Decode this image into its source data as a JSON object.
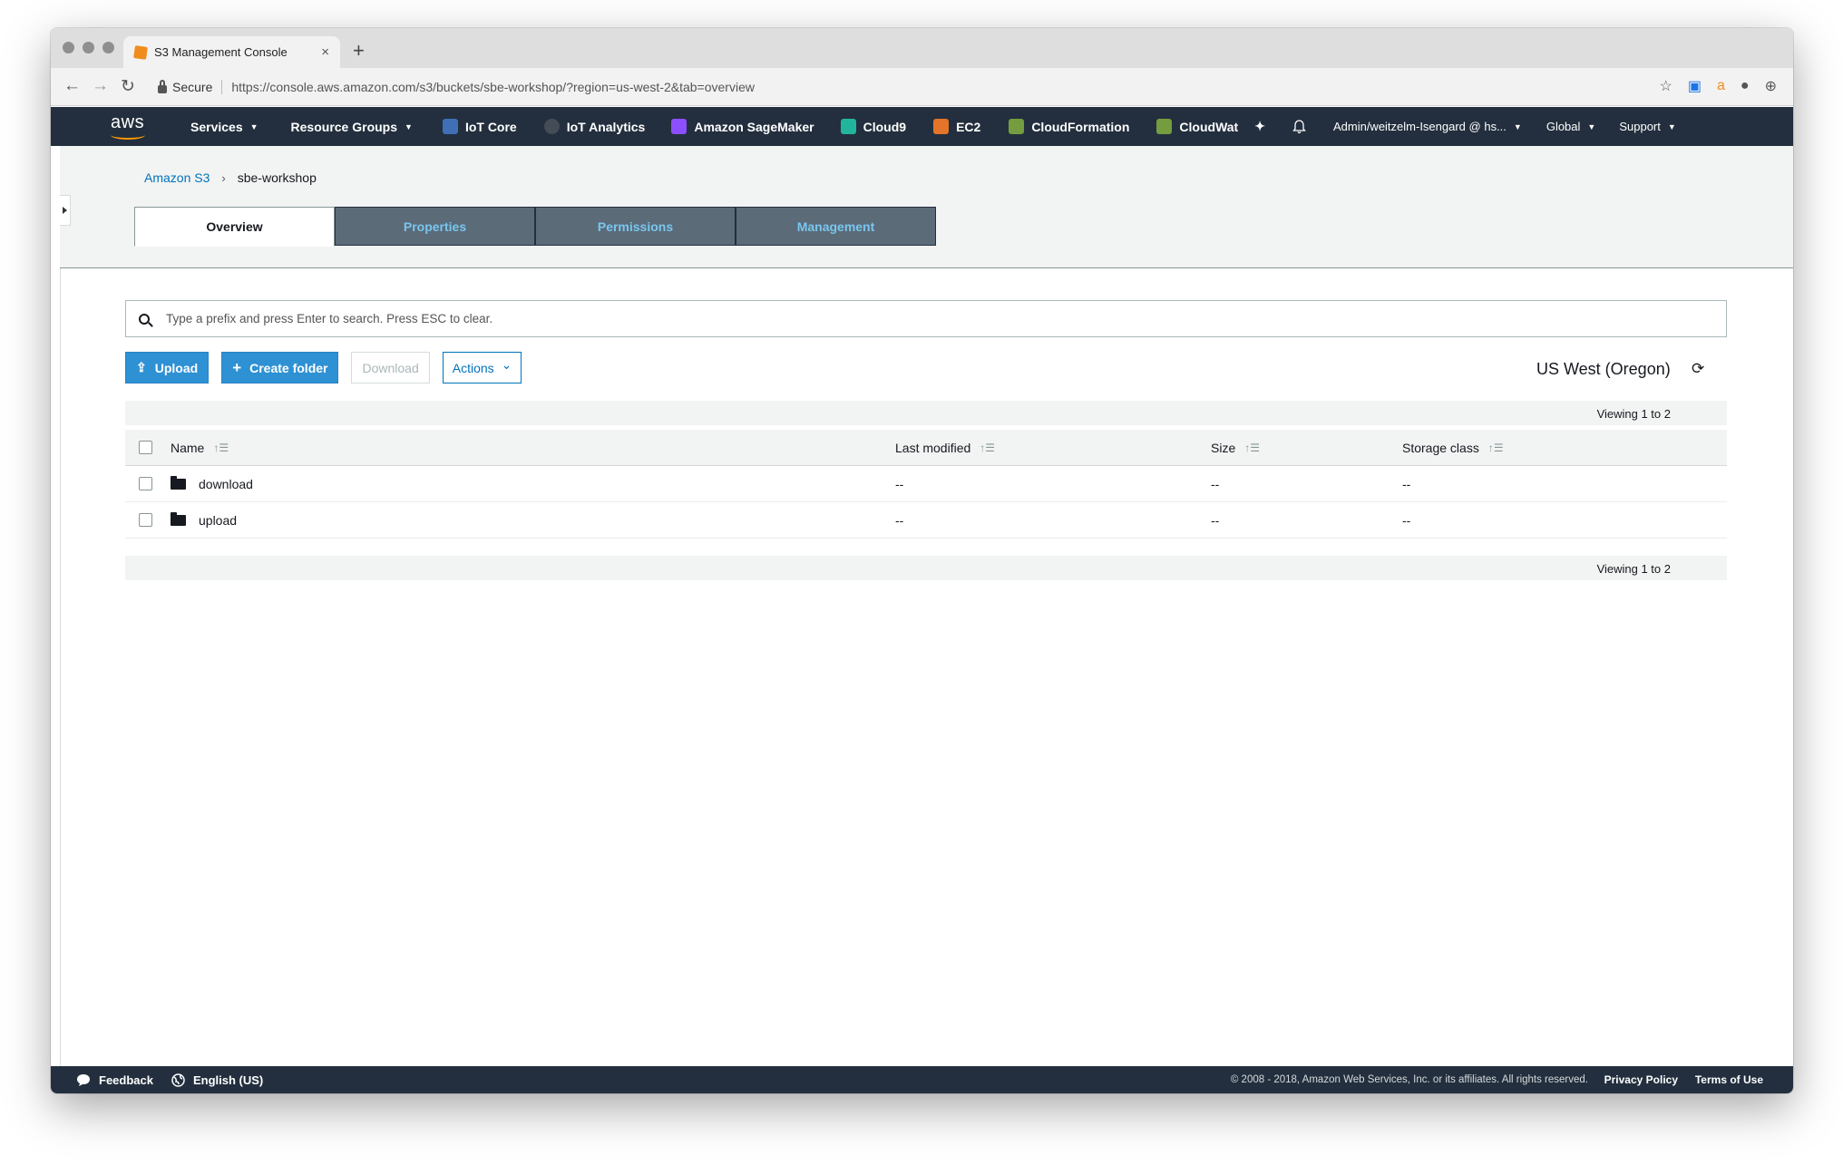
{
  "browser": {
    "tab_title": "S3 Management Console",
    "tab_close": "×",
    "new_tab": "+",
    "back": "←",
    "forward": "→",
    "reload": "↻",
    "secure_label": "Secure",
    "url": "https://console.aws.amazon.com/s3/buckets/sbe-workshop/?region=us-west-2&tab=overview",
    "extensions": [
      "☆",
      "▣",
      "a",
      "●",
      "⊕"
    ]
  },
  "aws_nav": {
    "logo_text": "aws",
    "services": "Services",
    "resource_groups": "Resource Groups",
    "shortcuts": [
      {
        "label": "IoT Core",
        "color": "#3f6fb5"
      },
      {
        "label": "IoT Analytics",
        "color": "#444c55"
      },
      {
        "label": "Amazon SageMaker",
        "color": "#8c4fff"
      },
      {
        "label": "Cloud9",
        "color": "#21b59e"
      },
      {
        "label": "EC2",
        "color": "#e3742a"
      },
      {
        "label": "CloudFormation",
        "color": "#759c3e"
      },
      {
        "label": "CloudWat",
        "color": "#759c3e"
      }
    ],
    "pin": "✦",
    "bell": "🔔",
    "account": "Admin/weitzelm-Isengard @ hs...",
    "region": "Global",
    "support": "Support"
  },
  "breadcrumb": {
    "root": "Amazon S3",
    "separator": "›",
    "current": "sbe-workshop"
  },
  "tabs": [
    "Overview",
    "Properties",
    "Permissions",
    "Management"
  ],
  "search": {
    "placeholder": "Type a prefix and press Enter to search. Press ESC to clear."
  },
  "toolbar": {
    "upload": "Upload",
    "upload_icon": "⇪",
    "create_folder": "Create folder",
    "create_icon": "+",
    "download": "Download",
    "actions": "Actions",
    "actions_caret": "⌄"
  },
  "region_label": "US West (Oregon)",
  "refresh_icon": "⟳",
  "viewing": "Viewing 1 to 2",
  "table": {
    "headers": [
      "Name",
      "Last modified",
      "Size",
      "Storage class"
    ],
    "sort_icon": "↑☰",
    "rows": [
      {
        "name": "download",
        "modified": "--",
        "size": "--",
        "storage": "--"
      },
      {
        "name": "upload",
        "modified": "--",
        "size": "--",
        "storage": "--"
      }
    ]
  },
  "footer": {
    "feedback": "Feedback",
    "language": "English (US)",
    "copyright": "© 2008 - 2018, Amazon Web Services, Inc. or its affiliates. All rights reserved.",
    "privacy": "Privacy Policy",
    "terms": "Terms of Use"
  },
  "colors": {
    "nav_bg": "#232f3e",
    "primary_button": "#2e91d4",
    "link": "#0073bb",
    "inactive_tab": "#5b6b78"
  }
}
